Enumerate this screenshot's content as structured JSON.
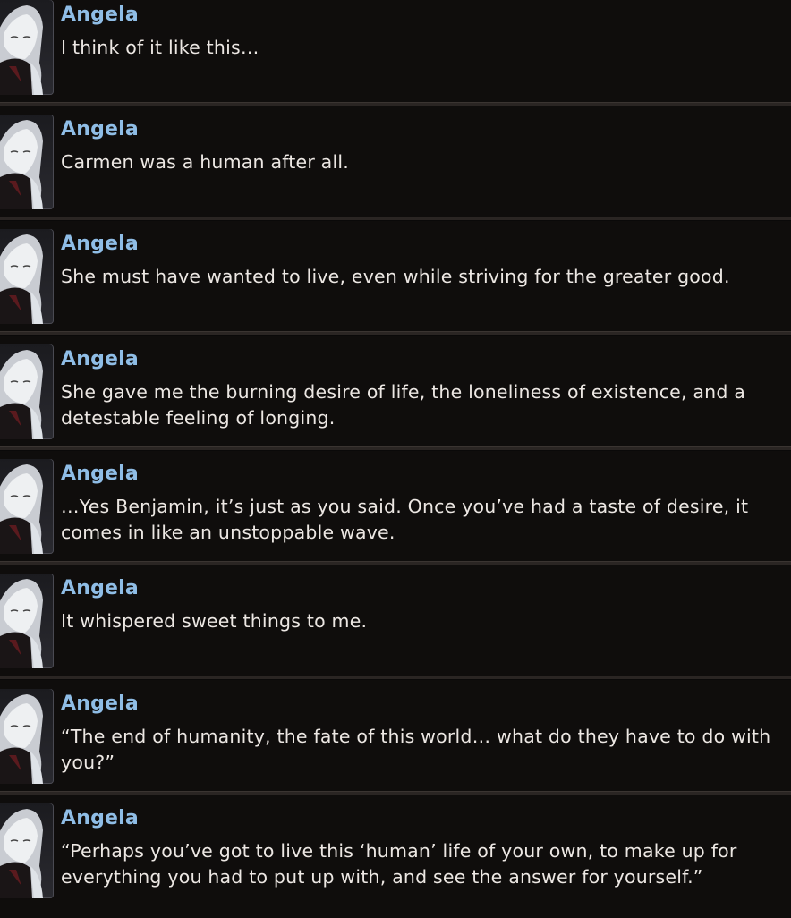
{
  "log": {
    "entries": [
      {
        "speaker": "Angela",
        "text": "I think of it like this…"
      },
      {
        "speaker": "Angela",
        "text": "Carmen was a human after all."
      },
      {
        "speaker": "Angela",
        "text": "She must have wanted to live, even while striving for the greater good."
      },
      {
        "speaker": "Angela",
        "text": "She gave me the burning desire of life, the loneliness of existence, and a detestable feeling of longing."
      },
      {
        "speaker": "Angela",
        "text": "…Yes Benjamin, it’s just as you said. Once you’ve had a taste of desire, it comes in like an unstoppable wave."
      },
      {
        "speaker": "Angela",
        "text": "It whispered sweet things to me."
      },
      {
        "speaker": "Angela",
        "text": "“The end of humanity, the fate of this world… what do they have to do with you?”"
      },
      {
        "speaker": "Angela",
        "text": "“Perhaps you’ve got to live this ‘human’ life of your own, to make up for everything you had to put up with, and see the answer for yourself.”"
      }
    ]
  },
  "colors": {
    "background": "#0f0d0c",
    "speaker": "#8fbde6",
    "text": "#ece7e3",
    "divider": "#2a2523"
  },
  "icons": {
    "portrait": "angela-portrait-icon"
  }
}
